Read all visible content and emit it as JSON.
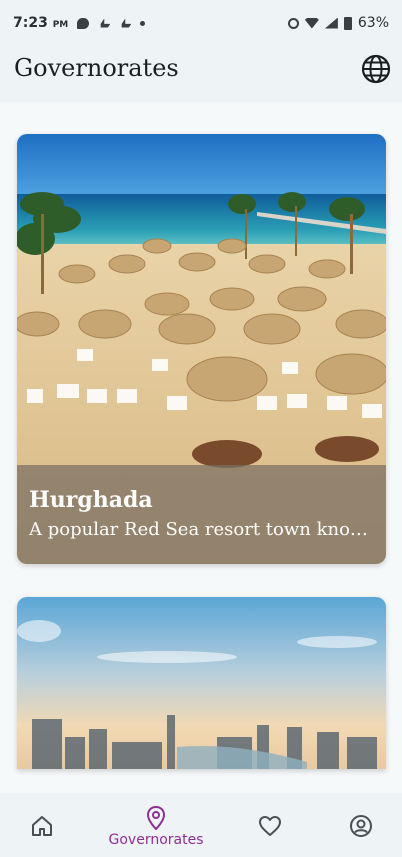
{
  "status_bar": {
    "time": "7:23",
    "ampm": "PM",
    "battery": "63%"
  },
  "header": {
    "title": "Governorates",
    "language_icon": "globe-icon"
  },
  "governorates": [
    {
      "name": "Hurghada",
      "description": "A popular Red Sea resort town known for its beaches and coral reefs"
    }
  ],
  "bottom_nav": {
    "items": [
      {
        "icon": "home-icon",
        "label": ""
      },
      {
        "icon": "location-pin-icon",
        "label": "Governorates"
      },
      {
        "icon": "heart-icon",
        "label": ""
      },
      {
        "icon": "profile-icon",
        "label": ""
      }
    ],
    "active_color": "#8f2f93",
    "inactive_color": "#4a4f54"
  }
}
